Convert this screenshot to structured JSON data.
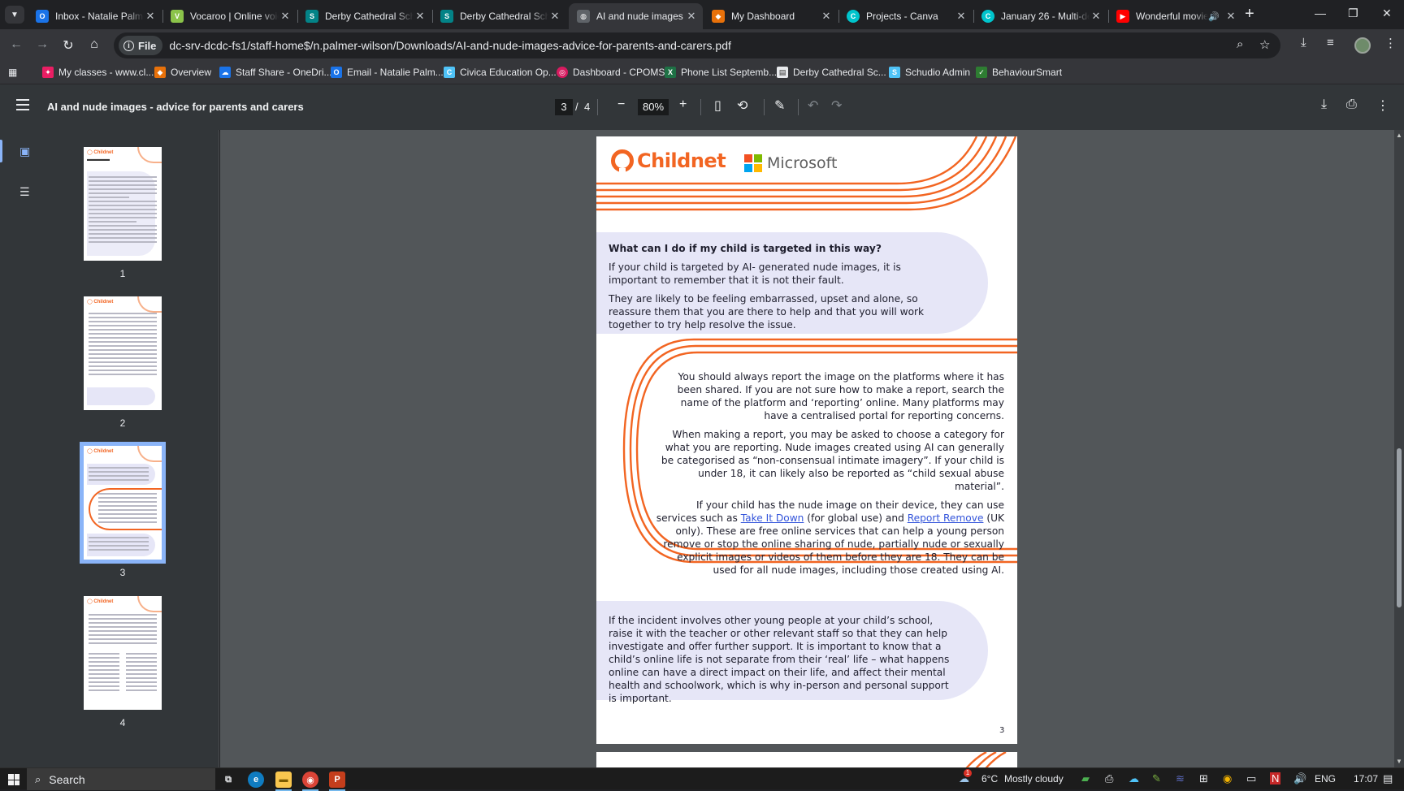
{
  "browser": {
    "tabs": [
      {
        "title": "Inbox - Natalie Palme",
        "icon": "outlook-icon",
        "color": "#1a73e8",
        "active": false
      },
      {
        "title": "Vocaroo | Online voic",
        "icon": "vocaroo-icon",
        "color": "#8bc34a",
        "active": false
      },
      {
        "title": "Derby Cathedral Scho",
        "icon": "sharepoint-icon",
        "color": "#038387",
        "active": false
      },
      {
        "title": "Derby Cathedral Scho",
        "icon": "sharepoint-icon",
        "color": "#038387",
        "active": false
      },
      {
        "title": "AI and nude images",
        "icon": "globe-icon",
        "color": "#9aa0a6",
        "active": true
      },
      {
        "title": "My Dashboard",
        "icon": "dashboard-icon",
        "color": "#e8710a",
        "active": false
      },
      {
        "title": "Projects - Canva",
        "icon": "canva-icon",
        "color": "#00c4cc",
        "active": false
      },
      {
        "title": "January 26 - Multi-de",
        "icon": "canva-icon",
        "color": "#00c4cc",
        "active": false
      },
      {
        "title": "Wonderful movie",
        "icon": "youtube-icon",
        "color": "#ff0000",
        "active": false
      }
    ],
    "url_scheme": "File",
    "url": "dc-srv-dcdc-fs1/staff-home$/n.palmer-wilson/Downloads/AI-and-nude-images-advice-for-parents-and-carers.pdf",
    "bookmarks": [
      {
        "label": "My classes - www.cl...",
        "icon": "classcharts-icon",
        "color": "#e91e63"
      },
      {
        "label": "Overview",
        "icon": "overview-icon",
        "color": "#e8710a"
      },
      {
        "label": "Staff Share - OneDri...",
        "icon": "onedrive-icon",
        "color": "#1a73e8"
      },
      {
        "label": "Email - Natalie Palm...",
        "icon": "outlook-icon",
        "color": "#1a73e8"
      },
      {
        "label": "Civica Education Op...",
        "icon": "civica-icon",
        "color": "#4fc3f7"
      },
      {
        "label": "Dashboard - CPOMS",
        "icon": "cpoms-icon",
        "color": "#d81b60"
      },
      {
        "label": "Phone List Septemb...",
        "icon": "excel-icon",
        "color": "#1e7145"
      },
      {
        "label": "Derby Cathedral Sc...",
        "icon": "document-icon",
        "color": "#e8eaed"
      },
      {
        "label": "Schudio Admin",
        "icon": "schudio-icon",
        "color": "#4fc3f7"
      },
      {
        "label": "BehaviourSmart",
        "icon": "behavioursmart-icon",
        "color": "#2e7d32"
      }
    ]
  },
  "pdf": {
    "title": "AI and nude images - advice for parents and carers",
    "current_page": "3",
    "page_sep": "/",
    "total_pages": "4",
    "zoom": "80%",
    "thumbnails": [
      {
        "num": "1"
      },
      {
        "num": "2"
      },
      {
        "num": "3"
      },
      {
        "num": "4"
      }
    ],
    "page": {
      "childnet_logo": "Childnet",
      "microsoft_logo": "Microsoft",
      "heading": "What can I do if my child is targeted in this way?",
      "para1": "If your child is targeted by AI- generated nude images, it is important to remember that it is not their fault.",
      "para2": "They are likely to be feeling embarrassed, upset and alone, so reassure them that you are there to help and that you will work together to try help resolve the issue.",
      "para3": "You should always report the image on the platforms where it has been shared. If you are not sure how to make a report, search the name of the platform and ‘reporting’ online. Many platforms may have a centralised portal for reporting concerns.",
      "para4": "When making a report, you may be asked to choose a category for what you are reporting. Nude images created using AI can generally be categorised as “non-consensual intimate imagery”. If your child is under 18, it can likely also be reported as “child sexual abuse material”.",
      "para5_a": "If your child has the nude image on their device, they can use services such as ",
      "link1": "Take It Down",
      "para5_b": " (for global use) and ",
      "link2": "Report Remove",
      "para5_c": " (UK only). These are free online services that can help a young person remove or stop the online sharing of nude, partially nude or sexually explicit images or videos of them before they are 18. They can be used for all nude images, including those created using AI.",
      "para6": "If the incident involves other young people at your child’s school, raise it with the teacher or other relevant staff so that they can help investigate and offer further support. It is important to know that a child’s online life is not separate from their ‘real’ life – what happens online can have a direct impact on their life, and affect their mental health and schoolwork, which is why in-person and personal support is important.",
      "page_number": "3"
    }
  },
  "taskbar": {
    "search_label": "Search",
    "weather_temp": "6°C",
    "weather_desc": "Mostly cloudy",
    "weather_badge": "1",
    "language": "ENG",
    "time": "17:07"
  },
  "colors": {
    "accent_orange": "#f26522",
    "lavender": "#e6e6f7",
    "link_blue": "#3455db",
    "chrome_dark": "#202124"
  }
}
